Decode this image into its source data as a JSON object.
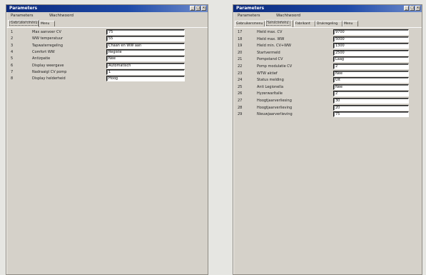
{
  "window1": {
    "title": "Parameters",
    "menu": [
      "Parameters",
      "Wachtwoord"
    ],
    "tabs": [
      "Gebruikersmenu",
      "Menu"
    ],
    "active_tab": 0,
    "rows": [
      {
        "num": "1",
        "label": "Max aanvoer CV",
        "value": "75"
      },
      {
        "num": "2",
        "label": "WW temperatuur",
        "value": "55"
      },
      {
        "num": "3",
        "label": "Tapwaterregeling",
        "value": "Chaan en WW aan"
      },
      {
        "num": "4",
        "label": "Comfort WW",
        "value": "Registe"
      },
      {
        "num": "5",
        "label": "Antizpatie",
        "value": "Nee"
      },
      {
        "num": "6",
        "label": "Display weergave",
        "value": "Automatisch"
      },
      {
        "num": "7",
        "label": "Nadraaigl CV pomp",
        "value": "1"
      },
      {
        "num": "8",
        "label": "Display helderheid",
        "value": "Hoog"
      }
    ]
  },
  "window2": {
    "title": "Parameters",
    "menu": [
      "Parameters",
      "Wachtwoord"
    ],
    "tabs": [
      "Gebruikersmenu",
      "Servicemenu",
      "Fabrikant",
      "Drukregeling",
      "Menu"
    ],
    "active_tab": 1,
    "rows": [
      {
        "num": "17",
        "label": "Hield max. CV",
        "value": "9700"
      },
      {
        "num": "18",
        "label": "Hield max. WW",
        "value": "5000"
      },
      {
        "num": "19",
        "label": "Hield min. CV+WW",
        "value": "1300"
      },
      {
        "num": "20",
        "label": "Startvermeld",
        "value": "2500"
      },
      {
        "num": "21",
        "label": "Pompstand CV",
        "value": "Laag"
      },
      {
        "num": "22",
        "label": "Pomp modulatie CV",
        "value": "2"
      },
      {
        "num": "23",
        "label": "WTW aktief",
        "value": "Nee"
      },
      {
        "num": "24",
        "label": "Status melding",
        "value": "Uit"
      },
      {
        "num": "25",
        "label": "Anti Legionella",
        "value": "Nee"
      },
      {
        "num": "26",
        "label": "Hyzerwarltalle",
        "value": "2"
      },
      {
        "num": "27",
        "label": "Hoogtjaarverliesing",
        "value": "30"
      },
      {
        "num": "28",
        "label": "Hoogtjaarverlieving",
        "value": "20"
      },
      {
        "num": "29",
        "label": "Nieuwjaarverlieving",
        "value": "75"
      }
    ]
  }
}
